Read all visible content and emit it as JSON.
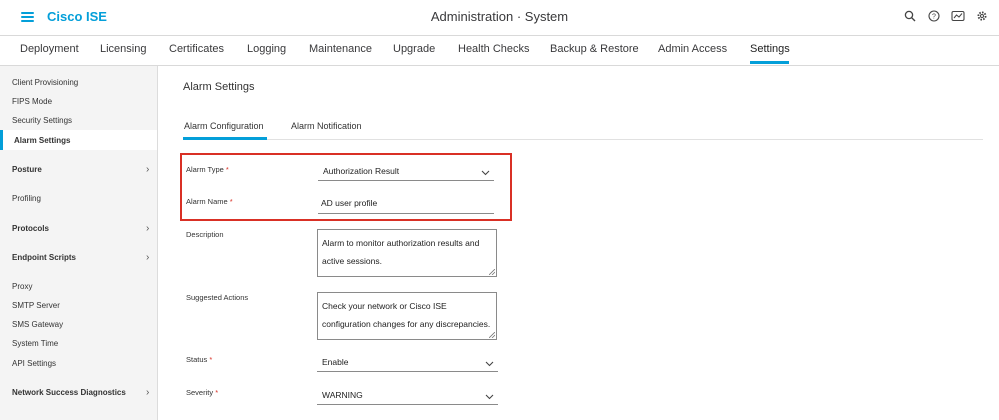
{
  "header": {
    "brand": "Cisco ISE",
    "title": "Administration · System"
  },
  "nav": {
    "tabs": [
      {
        "label": "Deployment"
      },
      {
        "label": "Licensing"
      },
      {
        "label": "Certificates"
      },
      {
        "label": "Logging"
      },
      {
        "label": "Maintenance"
      },
      {
        "label": "Upgrade"
      },
      {
        "label": "Health Checks"
      },
      {
        "label": "Backup & Restore"
      },
      {
        "label": "Admin Access"
      },
      {
        "label": "Settings"
      }
    ],
    "active": "Settings"
  },
  "sidebar": {
    "items": [
      {
        "label": "Client Provisioning"
      },
      {
        "label": "FIPS Mode"
      },
      {
        "label": "Security Settings"
      },
      {
        "label": "Alarm Settings"
      },
      {
        "label": "Posture"
      },
      {
        "label": "Profiling"
      },
      {
        "label": "Protocols"
      },
      {
        "label": "Endpoint Scripts"
      },
      {
        "label": "Proxy"
      },
      {
        "label": "SMTP Server"
      },
      {
        "label": "SMS Gateway"
      },
      {
        "label": "System Time"
      },
      {
        "label": "API Settings"
      },
      {
        "label": "Network Success Diagnostics"
      }
    ],
    "active": "Alarm Settings"
  },
  "main": {
    "title": "Alarm Settings",
    "subtabs": [
      {
        "label": "Alarm Configuration"
      },
      {
        "label": "Alarm Notification"
      }
    ],
    "active_subtab": "Alarm Configuration",
    "form": {
      "alarm_type": {
        "label": "Alarm Type",
        "value": "Authorization Result"
      },
      "alarm_name": {
        "label": "Alarm Name",
        "value": "AD user profile"
      },
      "description": {
        "label": "Description",
        "line1": "Alarm to monitor authorization results and",
        "line2": "active sessions."
      },
      "suggested_actions": {
        "label": "Suggested Actions",
        "line1": "Check your network or Cisco ISE",
        "line2": "configuration changes for any discrepancies."
      },
      "status": {
        "label": "Status",
        "value": "Enable"
      },
      "severity": {
        "label": "Severity",
        "value": "WARNING"
      },
      "required_mark": "*"
    }
  },
  "colors": {
    "accent": "#049fd9",
    "highlight": "#d93025",
    "required": "#d93025"
  },
  "icons": {
    "menu": "hamburger-icon",
    "search": "search-icon",
    "help": "help-icon",
    "dashboard": "dashboard-icon",
    "settings": "gear-icon"
  }
}
